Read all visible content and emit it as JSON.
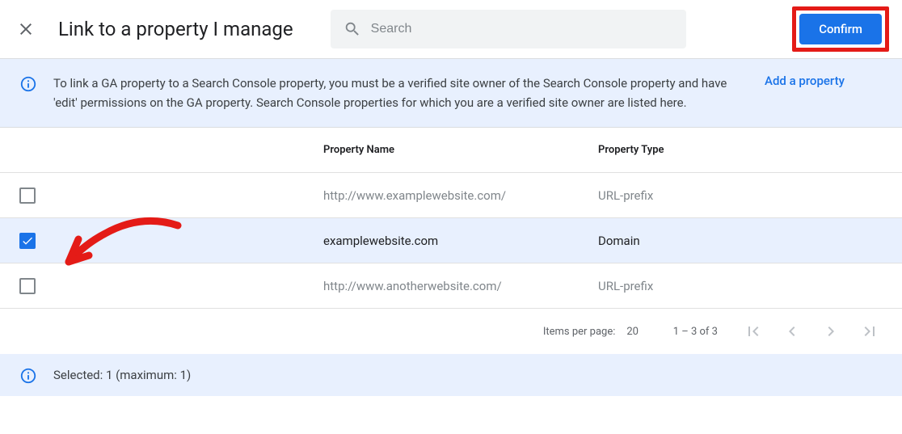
{
  "header": {
    "title": "Link to a property I manage",
    "search_placeholder": "Search",
    "confirm_label": "Confirm"
  },
  "info": {
    "text": "To link a GA property to a Search Console property, you must be a verified site owner of the Search Console property and have 'edit' permissions on the GA property. Search Console properties for which you are a verified site owner are listed here.",
    "add_property_label": "Add a property"
  },
  "table": {
    "headers": {
      "name": "Property Name",
      "type": "Property Type"
    },
    "rows": [
      {
        "checked": false,
        "name": "http://www.examplewebsite.com/",
        "type": "URL-prefix",
        "muted": true
      },
      {
        "checked": true,
        "name": "examplewebsite.com",
        "type": "Domain",
        "muted": false
      },
      {
        "checked": false,
        "name": "http://www.anotherwebsite.com/",
        "type": "URL-prefix",
        "muted": true
      }
    ]
  },
  "pagination": {
    "items_per_page_label": "Items per page:",
    "items_per_page_value": "20",
    "range_label": "1 – 3 of 3"
  },
  "footer": {
    "selected_label": "Selected: 1 (maximum: 1)"
  }
}
